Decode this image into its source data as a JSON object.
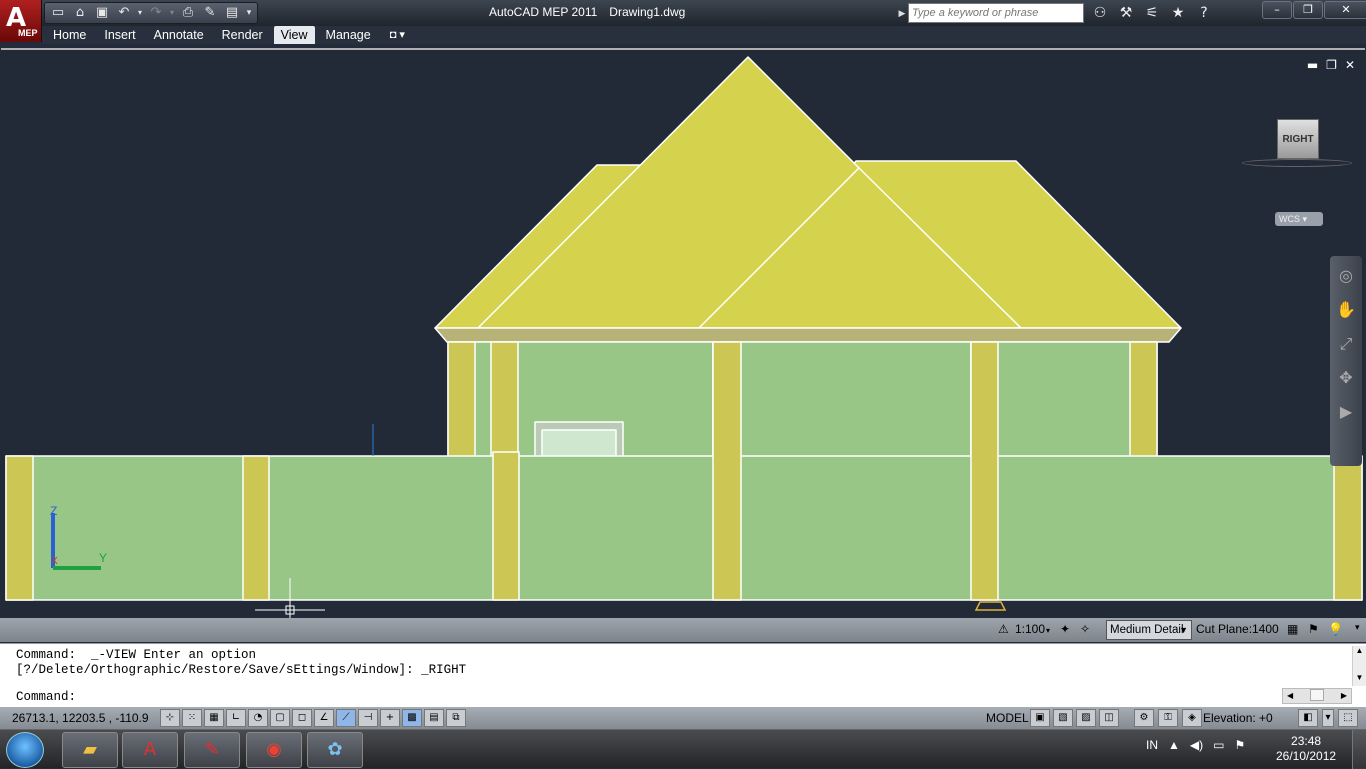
{
  "app": {
    "title": "AutoCAD MEP 2011",
    "file": "Drawing1.dwg",
    "app_button_badge": "MEP"
  },
  "search": {
    "placeholder": "Type a keyword or phrase"
  },
  "ribbon": {
    "tabs": [
      "Home",
      "Insert",
      "Annotate",
      "Render",
      "View",
      "Manage"
    ],
    "active_tab": "View"
  },
  "viewcube": {
    "face": "RIGHT",
    "wcs_label": "WCS"
  },
  "viewport_status": {
    "scale": "1:100",
    "detail_level": "Medium Detail",
    "cut_plane_label": "Cut Plane:",
    "cut_plane_value": "1400"
  },
  "command_line": {
    "history": [
      "Command:  _-VIEW Enter an option",
      "[?/Delete/Orthographic/Restore/Save/sEttings/Window]: _RIGHT"
    ],
    "prompt": "Command:"
  },
  "status_bar": {
    "coordinates": "26713.1,  12203.5 , -110.9",
    "space": "MODEL",
    "elevation_label": "Elevation:",
    "elevation_value": "+0"
  },
  "taskbar": {
    "language": "IN",
    "time": "23:48",
    "date": "26/10/2012",
    "apps": [
      "file-explorer",
      "autocad",
      "adobe-reader",
      "chrome",
      "paint"
    ]
  },
  "colors": {
    "viewport_bg": "#222a38",
    "roof": "#d5d34e",
    "column": "#ccc654",
    "wall": "#98c686",
    "outline": "#ffffff"
  }
}
